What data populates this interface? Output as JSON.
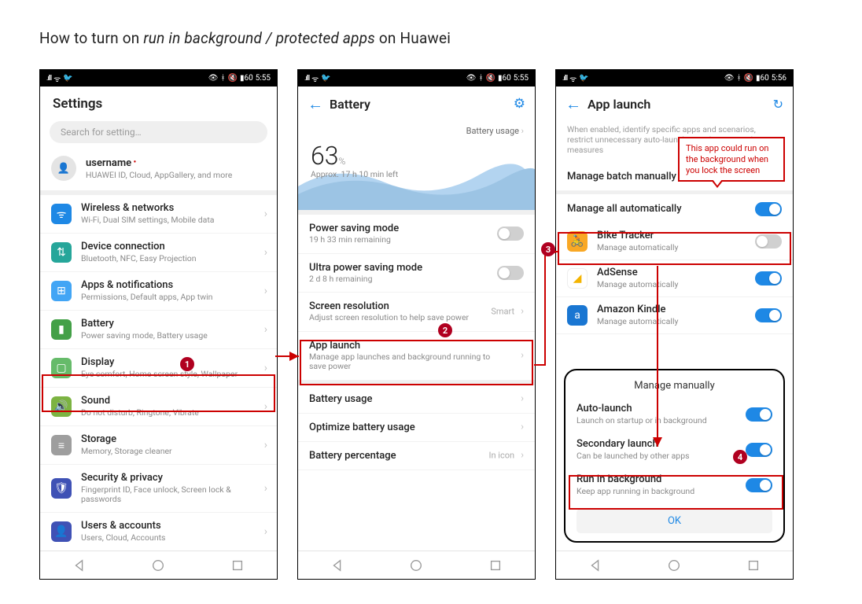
{
  "title_prefix": "How to turn on ",
  "title_em": "run in background / protected apps",
  "title_suffix": " on Huawei",
  "status": {
    "time1": "5:55",
    "time2": "5:55",
    "time3": "5:56",
    "batt": "60"
  },
  "screen1": {
    "header": "Settings",
    "search_placeholder": "Search for setting…",
    "username": "username",
    "user_sub": "HUAWEI ID, Cloud, AppGallery, and more",
    "items": [
      {
        "icon": "wifi-icon",
        "color": "#1E88E5",
        "title": "Wireless & networks",
        "sub": "Wi-Fi, Dual SIM settings, Mobile data"
      },
      {
        "icon": "bluetooth-icon",
        "color": "#26A69A",
        "title": "Device connection",
        "sub": "Bluetooth, NFC, Easy Projection"
      },
      {
        "icon": "apps-icon",
        "color": "#42A5F5",
        "title": "Apps & notifications",
        "sub": "Permissions, Default apps, App twin"
      },
      {
        "icon": "battery-icon",
        "color": "#43A047",
        "title": "Battery",
        "sub": "Power saving mode, Battery usage"
      },
      {
        "icon": "display-icon",
        "color": "#66BB6A",
        "title": "Display",
        "sub": "Eye comfort, Home screen style, Wallpaper"
      },
      {
        "icon": "sound-icon",
        "color": "#7CB342",
        "title": "Sound",
        "sub": "Do not disturb, Ringtone, Vibrate"
      },
      {
        "icon": "storage-icon",
        "color": "#9E9E9E",
        "title": "Storage",
        "sub": "Memory, Storage cleaner"
      },
      {
        "icon": "security-icon",
        "color": "#3F51B5",
        "title": "Security & privacy",
        "sub": "Fingerprint ID, Face unlock, Screen lock & passwords"
      },
      {
        "icon": "users-icon",
        "color": "#3F51B5",
        "title": "Users & accounts",
        "sub": "Users, Cloud, Accounts"
      }
    ]
  },
  "screen2": {
    "header": "Battery",
    "usage_link": "Battery usage",
    "pct": "63",
    "pct_unit": "%",
    "estimate": "Approx. 17 h 10 min left",
    "items": [
      {
        "title": "Power saving mode",
        "sub": "19 h 33 min remaining",
        "right": "toggle-off"
      },
      {
        "title": "Ultra power saving mode",
        "sub": "2 d 8 h remaining",
        "right": "toggle-off"
      },
      {
        "title": "Screen resolution",
        "sub": "Adjust screen resolution to help save power",
        "right": "smart",
        "right_text": "Smart"
      },
      {
        "title": "App launch",
        "sub": "Manage app launches and background running to save power",
        "right": "chev"
      },
      {
        "title": "Battery usage",
        "sub": "",
        "right": "chev"
      },
      {
        "title": "Optimize battery usage",
        "sub": "",
        "right": "chev"
      },
      {
        "title": "Battery percentage",
        "sub": "",
        "right": "text",
        "right_text": "In icon"
      }
    ]
  },
  "screen3": {
    "header": "App launch",
    "desc": "When enabled, identify specific apps and scenarios, restrict unnecessary auto-launches and power saving measures",
    "batch": "Manage batch manually",
    "manage_all": "Manage all automatically",
    "apps": [
      {
        "name": "BIke Tracker",
        "sub": "Manage automatically",
        "color": "#F9A825",
        "icon": "bike-icon",
        "toggle": "off"
      },
      {
        "name": "AdSense",
        "sub": "Manage automatically",
        "color": "#FFFFFF",
        "icon": "adsense-icon",
        "toggle": "on"
      },
      {
        "name": "Amazon Kindle",
        "sub": "Manage automatically",
        "color": "#1976D2",
        "icon": "kindle-icon",
        "toggle": "on"
      }
    ],
    "modal": {
      "title": "Manage manually",
      "items": [
        {
          "title": "Auto-launch",
          "sub": "Launch on startup or in background"
        },
        {
          "title": "Secondary launch",
          "sub": "Can be launched by other apps"
        },
        {
          "title": "Run in background",
          "sub": "Keep app running in background"
        }
      ],
      "ok": "OK"
    }
  },
  "annotations": {
    "callout": "This app could run on the background when you lock the screen"
  }
}
